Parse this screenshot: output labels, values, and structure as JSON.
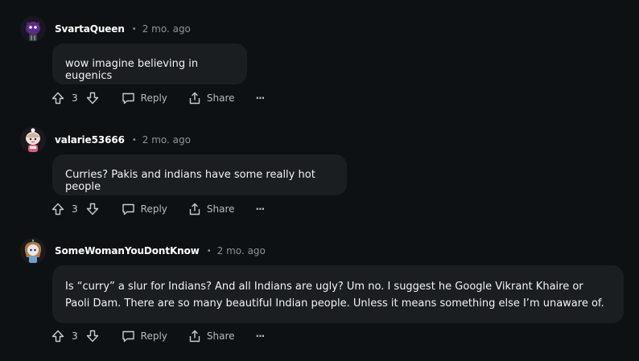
{
  "comments": [
    {
      "author": "SvartaQueen",
      "separator": "•",
      "time": "2 mo. ago",
      "body": "wow imagine believing in eugenics",
      "votes": "3",
      "reply_label": "Reply",
      "share_label": "Share",
      "more_label": "···",
      "avatar_color": "#6a2ea0"
    },
    {
      "author": "valarie53666",
      "separator": "•",
      "time": "2 mo. ago",
      "body": "Curries? Pakis and indians have some really hot people",
      "votes": "3",
      "reply_label": "Reply",
      "share_label": "Share",
      "more_label": "···",
      "avatar_color": "#f0d4c4"
    },
    {
      "author": "SomeWomanYouDontKnow",
      "separator": "•",
      "time": "2 mo. ago",
      "body": "Is “curry” a slur for Indians? And all Indians are ugly? Um no. I suggest he Google Vikrant Khaire or Paoli Dam. There are so many beautiful Indian people. Unless it means something else I’m unaware of.",
      "votes": "3",
      "reply_label": "Reply",
      "share_label": "Share",
      "more_label": "···",
      "avatar_color": "#c8a070"
    }
  ],
  "icons": {
    "upvote": "upvote-icon",
    "downvote": "downvote-icon",
    "reply": "comment-bubble-icon",
    "share": "share-icon",
    "more": "more-options-icon"
  },
  "colors": {
    "background": "#0e1113",
    "bubble": "#1b1e21",
    "muted_text": "#8b9397"
  }
}
